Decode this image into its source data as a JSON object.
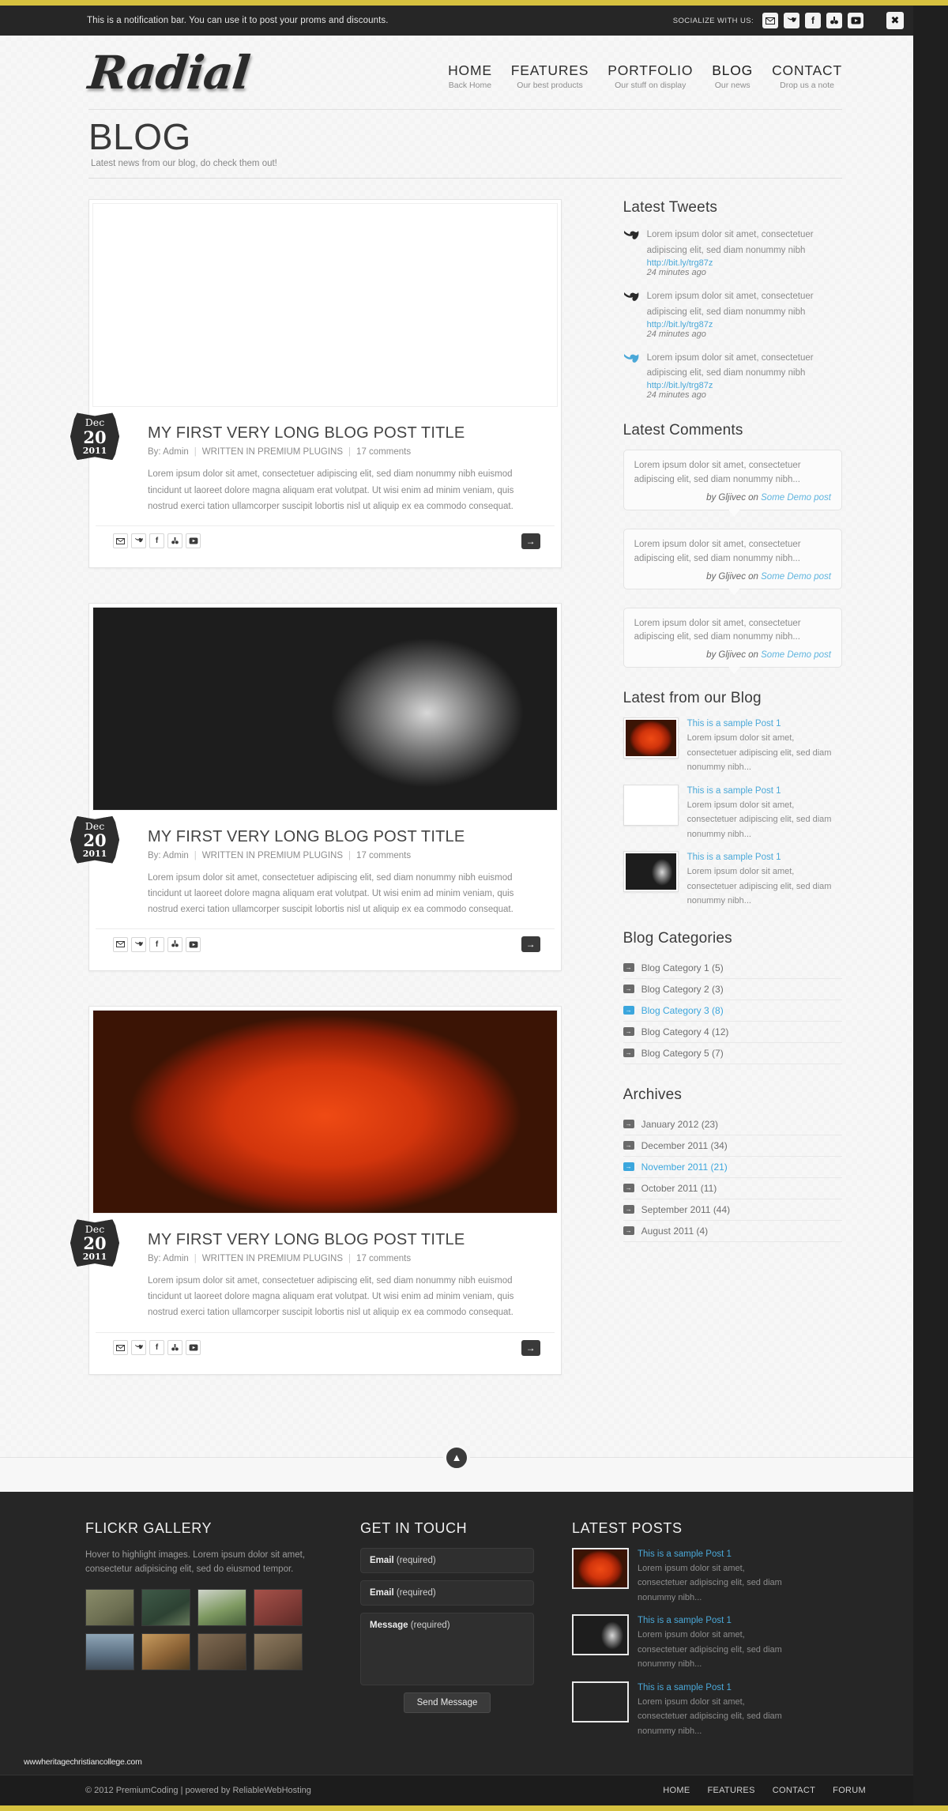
{
  "notification": {
    "text": "This is a notification bar. You can use it to post your proms and discounts.",
    "socialize_label": "SOCIALIZE WITH US:",
    "icons": [
      "mail-icon",
      "twitter-icon",
      "facebook-icon",
      "flickr-icon",
      "youtube-icon"
    ],
    "close_label": "✖"
  },
  "header": {
    "logo": "Radial",
    "nav": [
      {
        "title": "HOME",
        "sub": "Back Home"
      },
      {
        "title": "FEATURES",
        "sub": "Our best products"
      },
      {
        "title": "PORTFOLIO",
        "sub": "Our stuff on display"
      },
      {
        "title": "BLOG",
        "sub": "Our news"
      },
      {
        "title": "CONTACT",
        "sub": "Drop us a note"
      }
    ]
  },
  "page": {
    "title": "BLOG",
    "subtitle": "Latest news from our blog, do check them out!"
  },
  "posts": [
    {
      "image": "ph-straw",
      "date": {
        "month": "Dec",
        "day": "20",
        "year": "2011"
      },
      "title": "MY FIRST VERY LONG BLOG POST TITLE",
      "author": "By: Admin",
      "category": "WRITTEN IN PREMIUM PLUGINS",
      "comments": "17 comments",
      "excerpt": "Lorem ipsum dolor sit amet, consectetuer adipiscing elit, sed diam nonummy nibh euismod tincidunt ut laoreet dolore magna aliquam erat volutpat. Ut wisi enim ad minim veniam, quis nostrud exerci tation ullamcorper suscipit lobortis nisl ut aliquip ex ea commodo consequat."
    },
    {
      "image": "ph-roses",
      "date": {
        "month": "Dec",
        "day": "20",
        "year": "2011"
      },
      "title": "MY FIRST VERY LONG BLOG POST TITLE",
      "author": "By: Admin",
      "category": "WRITTEN IN PREMIUM PLUGINS",
      "comments": "17 comments",
      "excerpt": "Lorem ipsum dolor sit amet, consectetuer adipiscing elit, sed diam nonummy nibh euismod tincidunt ut laoreet dolore magna aliquam erat volutpat. Ut wisi enim ad minim veniam, quis nostrud exerci tation ullamcorper suscipit lobortis nisl ut aliquip ex ea commodo consequat."
    },
    {
      "image": "ph-tomato",
      "date": {
        "month": "Dec",
        "day": "20",
        "year": "2011"
      },
      "title": "MY FIRST VERY LONG BLOG POST TITLE",
      "author": "By: Admin",
      "category": "WRITTEN IN PREMIUM PLUGINS",
      "comments": "17 comments",
      "excerpt": "Lorem ipsum dolor sit amet, consectetuer adipiscing elit, sed diam nonummy nibh euismod tincidunt ut laoreet dolore magna aliquam erat volutpat. Ut wisi enim ad minim veniam, quis nostrud exerci tation ullamcorper suscipit lobortis nisl ut aliquip ex ea commodo consequat."
    }
  ],
  "share_icons": [
    "mail-icon",
    "twitter-icon",
    "facebook-icon",
    "flickr-icon",
    "youtube-icon"
  ],
  "sidebar": {
    "tweets_heading": "Latest Tweets",
    "tweets": [
      {
        "text": "Lorem ipsum dolor sit amet, consectetuer adipiscing elit, sed diam nonummy nibh",
        "link": "http://bit.ly/trg87z",
        "time": "24 minutes ago"
      },
      {
        "text": "Lorem ipsum dolor sit amet, consectetuer adipiscing elit, sed diam nonummy nibh",
        "link": "http://bit.ly/trg87z",
        "time": "24 minutes ago"
      },
      {
        "text": "Lorem ipsum dolor sit amet, consectetuer adipiscing elit, sed diam nonummy nibh",
        "link": "http://bit.ly/trg87z",
        "time": "24 minutes ago"
      }
    ],
    "comments_heading": "Latest Comments",
    "comments": [
      {
        "text": "Lorem ipsum dolor sit amet, consectetuer adipiscing elit, sed diam nonummy nibh...",
        "by": "by Gljivec on",
        "post": "Some Demo post"
      },
      {
        "text": "Lorem ipsum dolor sit amet, consectetuer adipiscing elit, sed diam nonummy nibh...",
        "by": "by Gljivec on",
        "post": "Some Demo post"
      },
      {
        "text": "Lorem ipsum dolor sit amet, consectetuer adipiscing elit, sed diam nonummy nibh...",
        "by": "by Gljivec on",
        "post": "Some Demo post"
      }
    ],
    "blog_heading": "Latest from our Blog",
    "blog_items": [
      {
        "image": "ph-tomato",
        "title": "This is a sample Post 1",
        "text": "Lorem ipsum dolor sit amet, consectetuer adipiscing elit, sed diam nonummy nibh..."
      },
      {
        "image": "ph-straw",
        "title": "This is a sample Post 1",
        "text": "Lorem ipsum dolor sit amet, consectetuer adipiscing elit, sed diam nonummy nibh..."
      },
      {
        "image": "ph-roses",
        "title": "This is a sample Post 1",
        "text": "Lorem ipsum dolor sit amet, consectetuer adipiscing elit, sed diam nonummy nibh..."
      }
    ],
    "categories_heading": "Blog Categories",
    "categories": [
      {
        "label": "Blog Category 1 (5)",
        "active": false
      },
      {
        "label": "Blog Category 2 (3)",
        "active": false
      },
      {
        "label": "Blog Category 3 (8)",
        "active": true
      },
      {
        "label": "Blog Category 4 (12)",
        "active": false
      },
      {
        "label": "Blog Category 5 (7)",
        "active": false
      }
    ],
    "archives_heading": "Archives",
    "archives": [
      {
        "label": "January 2012 (23)",
        "active": false
      },
      {
        "label": "December 2011 (34)",
        "active": false
      },
      {
        "label": "November 2011 (21)",
        "active": true
      },
      {
        "label": "October 2011 (11)",
        "active": false
      },
      {
        "label": "September 2011 (44)",
        "active": false
      },
      {
        "label": "August 2011 (4)",
        "active": false
      }
    ]
  },
  "scroll_top": "▲",
  "footer": {
    "flickr_heading": "FLICKR GALLERY",
    "flickr_desc": "Hover to highlight images. Lorem ipsum dolor sit amet, consectetur adipisicing elit, sed do eiusmod tempor.",
    "flickr_thumbs": [
      "ph-g1",
      "ph-g2",
      "ph-g3",
      "ph-g4",
      "ph-g5",
      "ph-g6",
      "ph-g7",
      "ph-g8"
    ],
    "contact_heading": "GET IN TOUCH",
    "fields": [
      {
        "strong": "Email",
        "rest": " (required)"
      },
      {
        "strong": "Email",
        "rest": " (required)"
      },
      {
        "strong": "Message",
        "rest": " (required)"
      }
    ],
    "send_label": "Send Message",
    "posts_heading": "LATEST POSTS",
    "posts": [
      {
        "image": "ph-tomato",
        "title": "This is a sample Post 1",
        "text": "Lorem ipsum dolor sit amet, consectetuer adipiscing elit, sed diam nonummy nibh..."
      },
      {
        "image": "ph-roses",
        "title": "This is a sample Post 1",
        "text": "Lorem ipsum dolor sit amet, consectetuer adipiscing elit, sed diam nonummy nibh..."
      },
      {
        "image": "ph-straw",
        "title": "This is a sample Post 1",
        "text": "Lorem ipsum dolor sit amet, consectetuer adipiscing elit, sed diam nonummy nibh..."
      }
    ],
    "watermark": "wwwheritagechristiancollege.com",
    "copyright": "© 2012 PremiumCoding | powered by ReliableWebHosting",
    "bottom_nav": [
      "HOME",
      "FEATURES",
      "CONTACT",
      "FORUM"
    ]
  },
  "colors": {
    "gold": "#d6c13f",
    "dark": "#262626",
    "link_blue": "#4aa8d8"
  }
}
